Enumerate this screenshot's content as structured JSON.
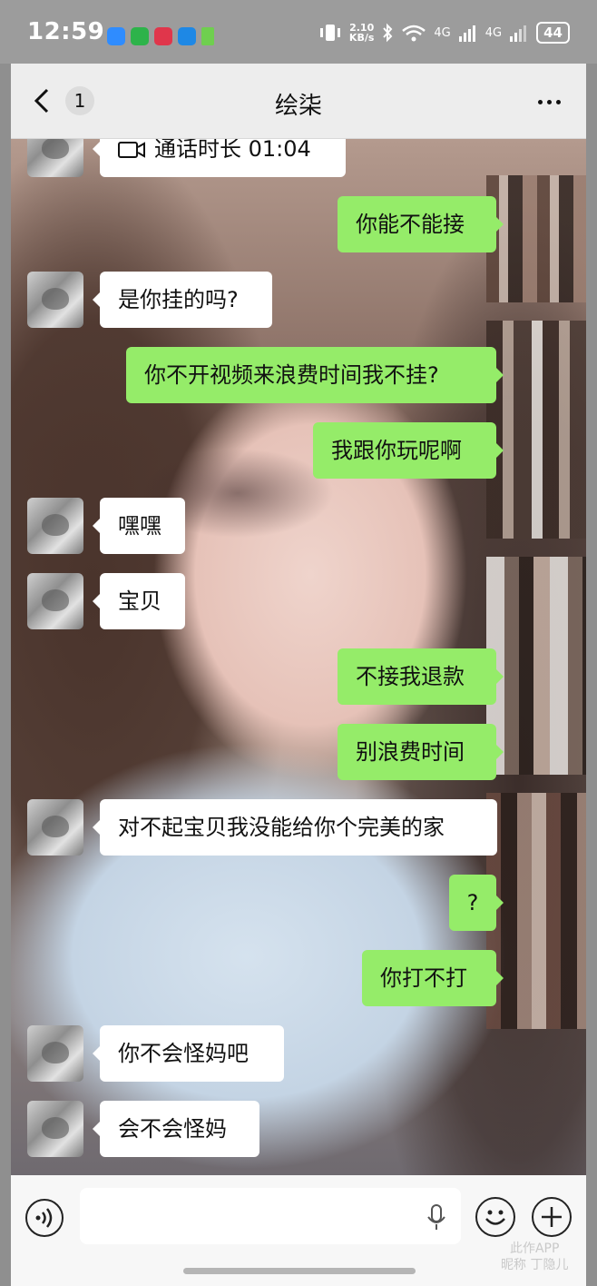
{
  "status_bar": {
    "time": "12:59",
    "net_speed_value": "2.10",
    "net_speed_unit": "KB/s",
    "signal1": "4G",
    "signal2": "4G",
    "battery": "44",
    "app_icons": [
      "qq-icon",
      "wechat-icon",
      "video-app-icon",
      "mail-app-icon",
      "play-icon"
    ]
  },
  "nav": {
    "unread_count": "1",
    "title": "绘柒"
  },
  "messages": [
    {
      "side": "in",
      "text": "通话时长 01:04",
      "type": "video-call"
    },
    {
      "side": "out",
      "text": "你能不能接"
    },
    {
      "side": "in",
      "text": "是你挂的吗?"
    },
    {
      "side": "out",
      "text": "你不开视频来浪费时间我不挂?"
    },
    {
      "side": "out",
      "text": "我跟你玩呢啊"
    },
    {
      "side": "in",
      "text": "嘿嘿"
    },
    {
      "side": "in",
      "text": "宝贝"
    },
    {
      "side": "out",
      "text": "不接我退款"
    },
    {
      "side": "out",
      "text": "别浪费时间"
    },
    {
      "side": "in",
      "text": "对不起宝贝我没能给你个完美的家"
    },
    {
      "side": "out",
      "text": "?"
    },
    {
      "side": "out",
      "text": "你打不打"
    },
    {
      "side": "in",
      "text": "你不会怪妈吧"
    },
    {
      "side": "in",
      "text": "会不会怪妈"
    }
  ],
  "input": {
    "value": ""
  },
  "watermark": {
    "line1": "此作APP",
    "line2": "昵称 丁隐儿"
  },
  "colors": {
    "outgoing_bubble": "#95ec69",
    "incoming_bubble": "#ffffff",
    "nav_background": "#ededed"
  }
}
